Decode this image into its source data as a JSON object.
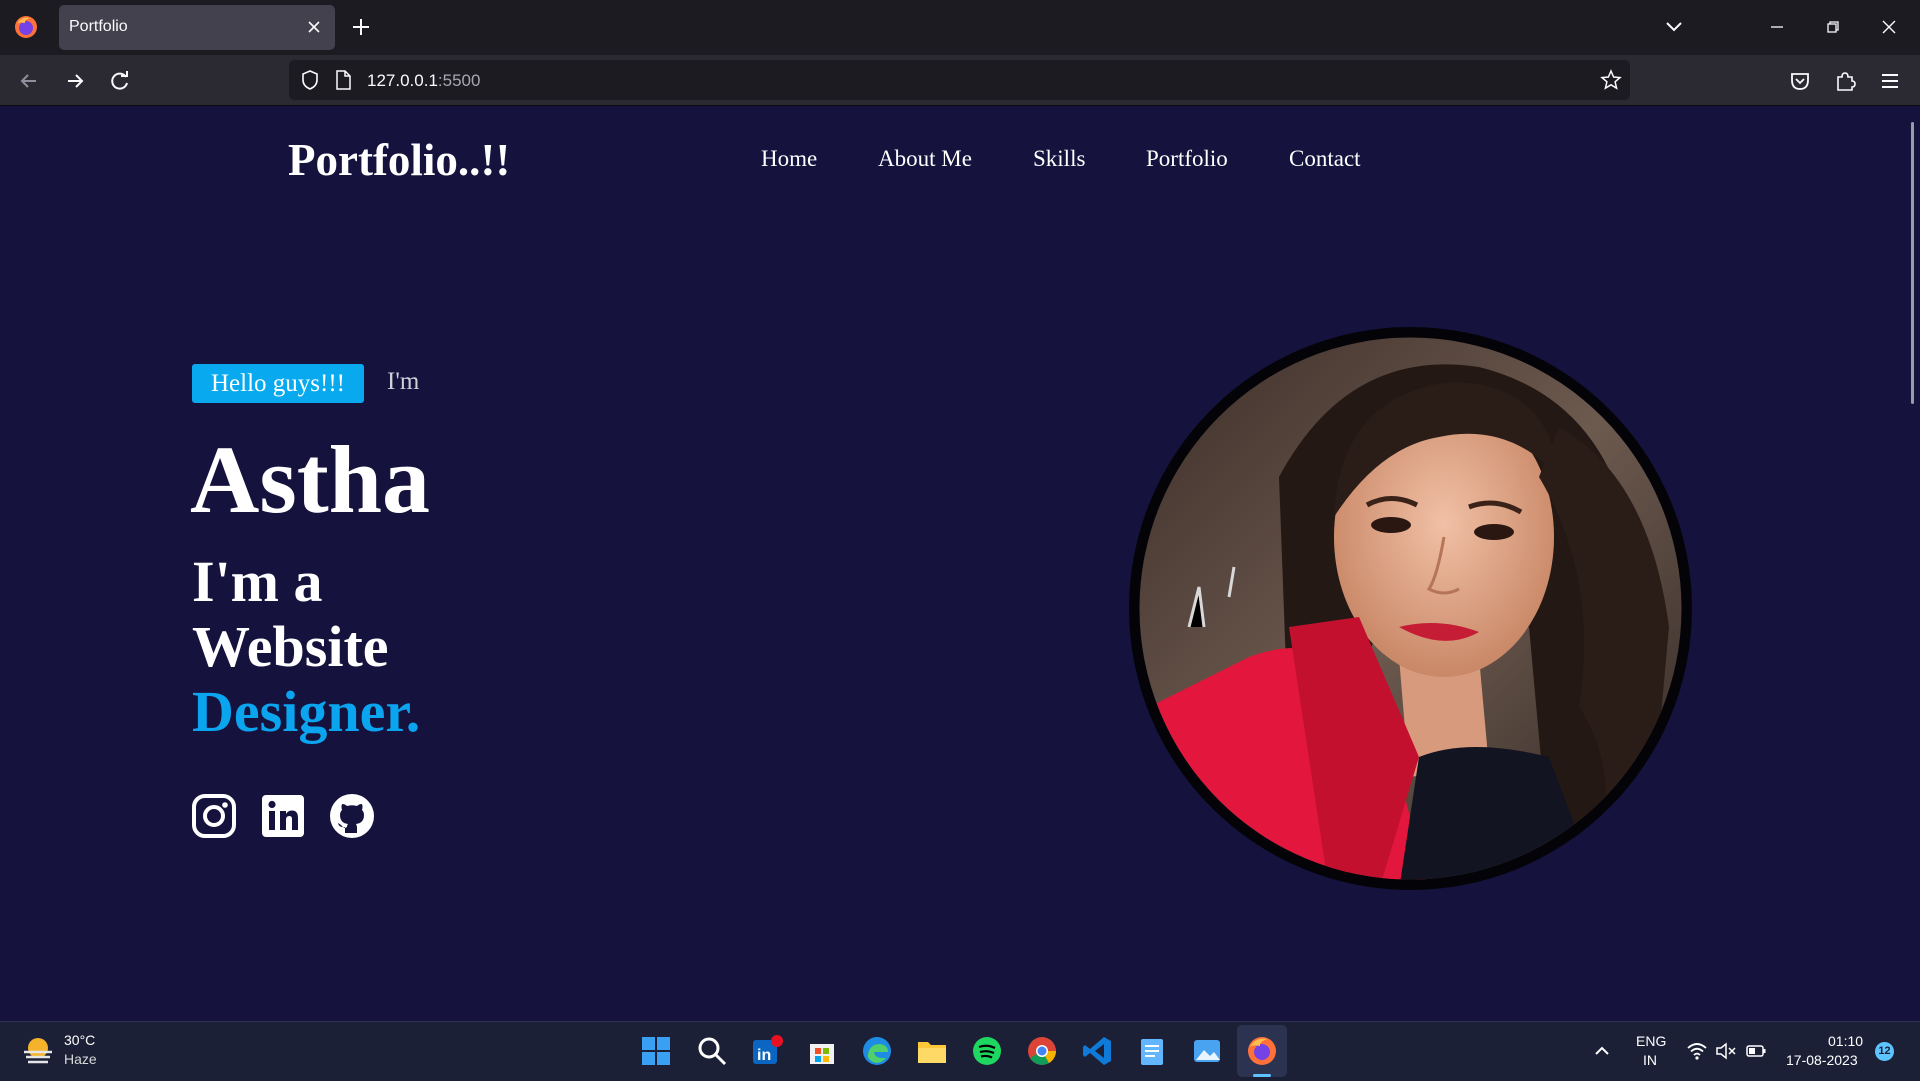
{
  "browser": {
    "tab_title": "Portfolio",
    "url_host": "127.0.0.1",
    "url_port": ":5500"
  },
  "site": {
    "brand": "Portfolio..!!",
    "nav": [
      "Home",
      "About Me",
      "Skills",
      "Portfolio",
      "Contact"
    ],
    "hello_badge": "Hello guys!!!",
    "intro": "I'm",
    "name": "Astha",
    "role_line1": "I'm a",
    "role_line2": "Website",
    "role_line3": "Designer.",
    "accent_color": "#0aa4ef",
    "background_color": "#15123d",
    "social_icons": [
      "instagram-icon",
      "linkedin-icon",
      "github-icon"
    ]
  },
  "taskbar": {
    "weather_temp": "30°C",
    "weather_desc": "Haze",
    "lang_line1": "ENG",
    "lang_line2": "IN",
    "time": "01:10",
    "date": "17-08-2023",
    "notification_count": "12"
  }
}
